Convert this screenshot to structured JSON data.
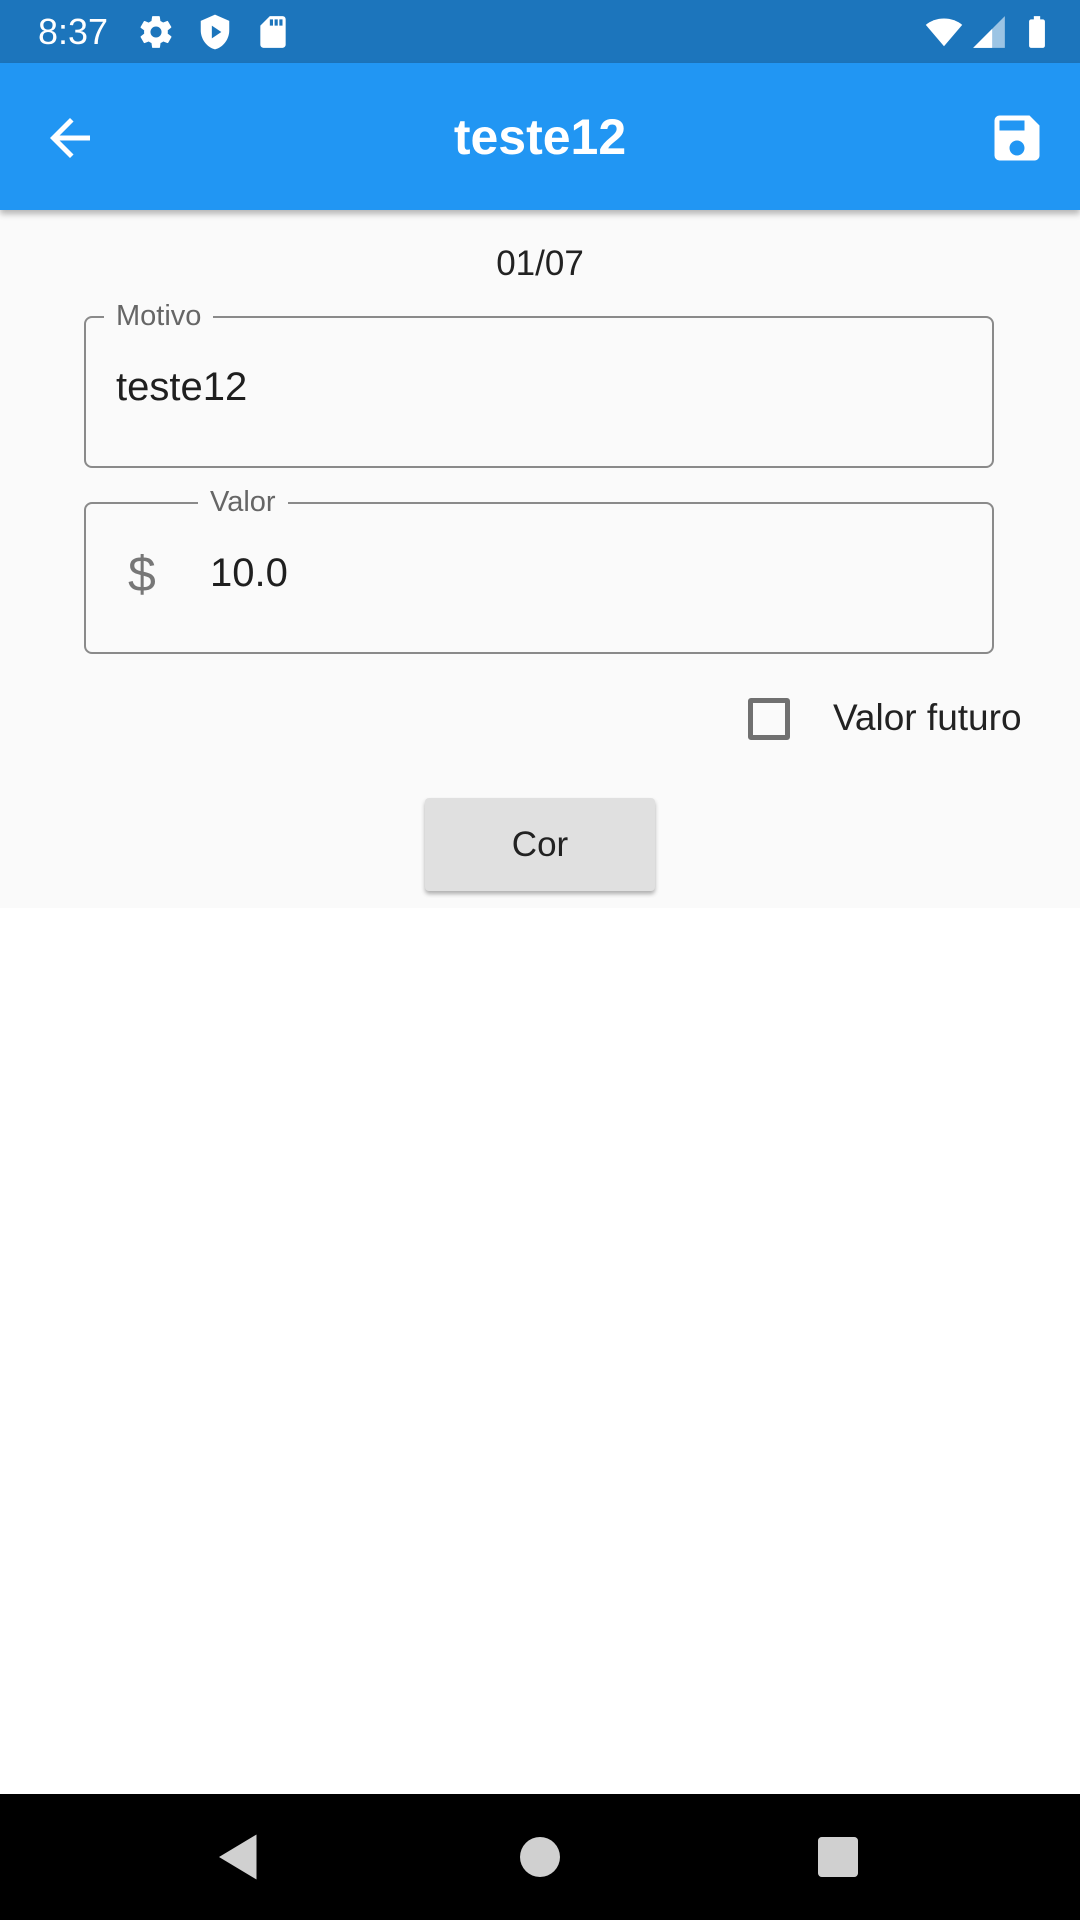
{
  "status_bar": {
    "time": "8:37"
  },
  "app_bar": {
    "title": "teste12"
  },
  "form": {
    "date": "01/07",
    "motivo": {
      "label": "Motivo",
      "value": "teste12"
    },
    "valor": {
      "label": "Valor",
      "prefix": "$",
      "value": "10.0"
    },
    "future_value": {
      "label": "Valor futuro",
      "checked": false
    },
    "color_button": {
      "label": "Cor"
    }
  },
  "colors": {
    "status_bar": "#1c75bc",
    "app_bar": "#2196f3",
    "content_bg": "#fafafa",
    "button_bg": "#e0e0e0"
  }
}
